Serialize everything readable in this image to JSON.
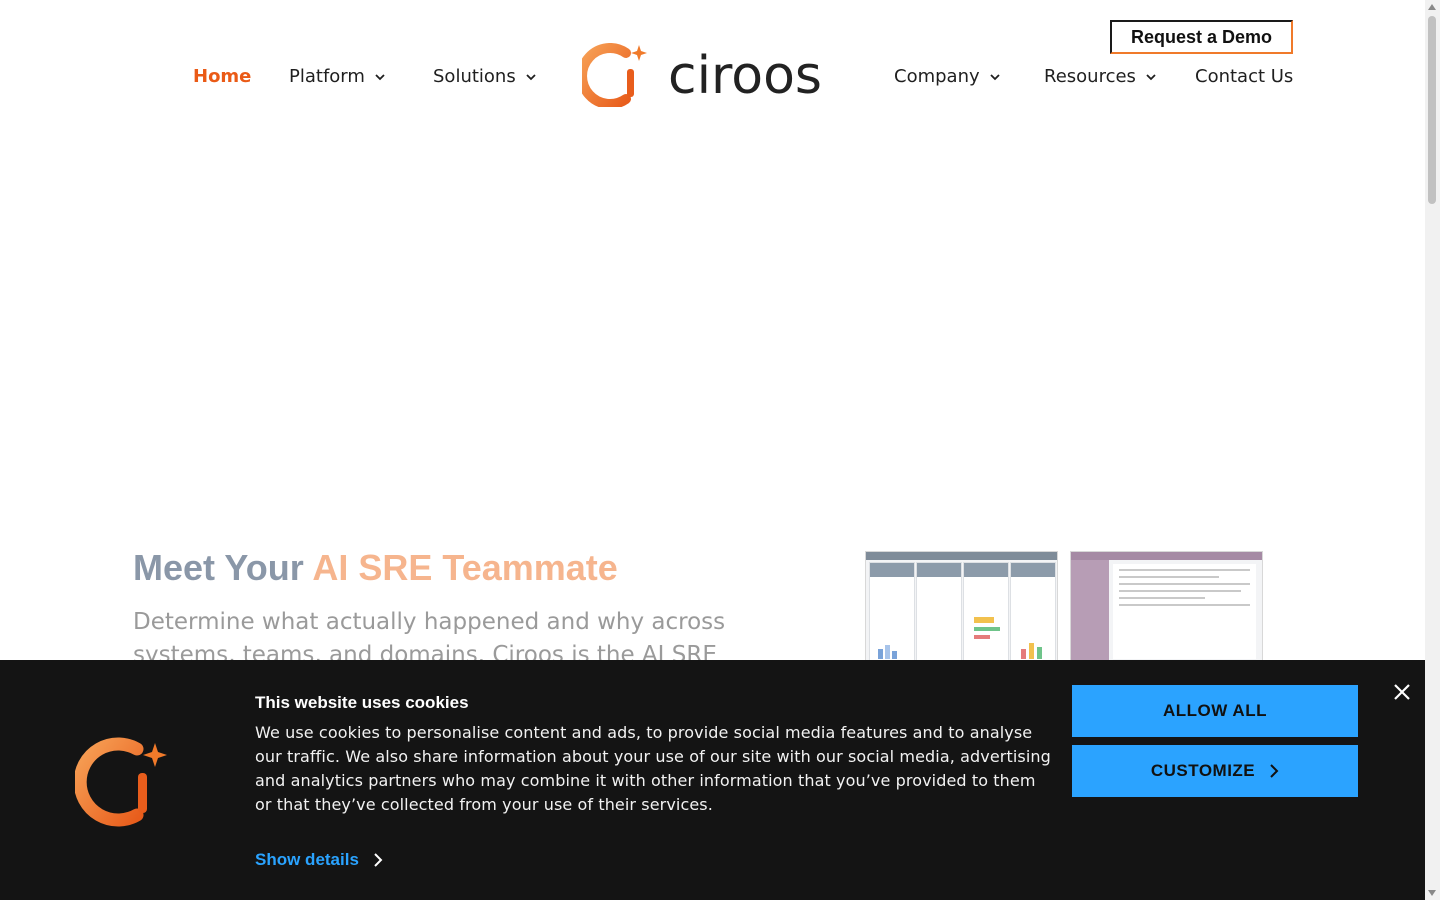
{
  "header": {
    "demo_button": "Request a Demo",
    "nav_left": [
      {
        "label": "Home",
        "active": true,
        "dropdown": false
      },
      {
        "label": "Platform",
        "active": false,
        "dropdown": true
      },
      {
        "label": "Solutions",
        "active": false,
        "dropdown": true
      }
    ],
    "nav_right": [
      {
        "label": "Company",
        "active": false,
        "dropdown": true
      },
      {
        "label": "Resources",
        "active": false,
        "dropdown": true
      },
      {
        "label": "Contact Us",
        "active": false,
        "dropdown": false
      }
    ],
    "logo_text": "ciroos",
    "accent_color": "#ea5a16"
  },
  "hero": {
    "title_prefix": "Meet Your ",
    "title_accent": "AI SRE Teammate",
    "subtitle": "Determine what actually happened and why across systems, teams, and domains. Ciroos is the AI SRE"
  },
  "cookie_banner": {
    "title": "This website uses cookies",
    "text": "We use cookies to personalise content and ads, to provide social media features and to analyse our traffic. We also share information about your use of our site with our social media, advertising and analytics partners who may combine it with other information that you’ve provided to them or that they’ve collected from your use of their services.",
    "show_details": "Show details",
    "allow_all": "ALLOW ALL",
    "customize": "CUSTOMIZE",
    "button_color": "#2ba3ff",
    "background": "#141414"
  },
  "icons": {
    "close": "close-icon",
    "chevron": "chevron-down-icon",
    "chevron_right": "chevron-right-icon"
  }
}
